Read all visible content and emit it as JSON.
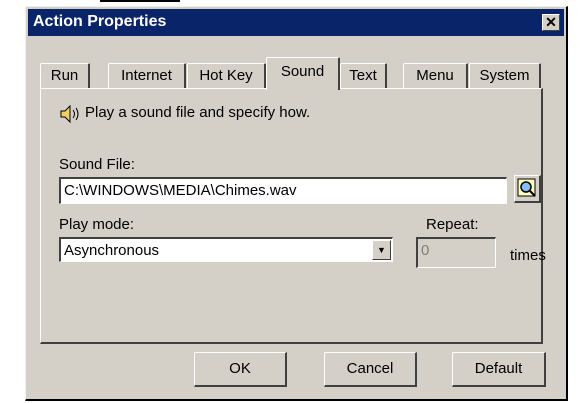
{
  "window": {
    "title": "Action Properties",
    "close_glyph": "✕"
  },
  "tabs": [
    {
      "label": "Run"
    },
    {
      "label": "Internet"
    },
    {
      "label": "Hot Key"
    },
    {
      "label": "Sound"
    },
    {
      "label": "Text"
    },
    {
      "label": "Menu"
    },
    {
      "label": "System"
    }
  ],
  "active_tab": "Sound",
  "sound_tab": {
    "description": "Play a sound file and specify how.",
    "sound_file_label": "Sound File:",
    "sound_file_value": "C:\\WINDOWS\\MEDIA\\Chimes.wav",
    "play_mode_label": "Play mode:",
    "play_mode_value": "Asynchronous",
    "dropdown_arrow": "▼",
    "repeat_label": "Repeat:",
    "repeat_value": "0",
    "times_label": "times"
  },
  "buttons": {
    "ok": "OK",
    "cancel": "Cancel",
    "default": "Default"
  },
  "icons": {
    "speaker": "speaker-icon",
    "browse": "browse-magnifier-icon"
  },
  "colors": {
    "titlebar": "#0a246a",
    "face": "#d4d0c8",
    "shadow": "#404040"
  }
}
